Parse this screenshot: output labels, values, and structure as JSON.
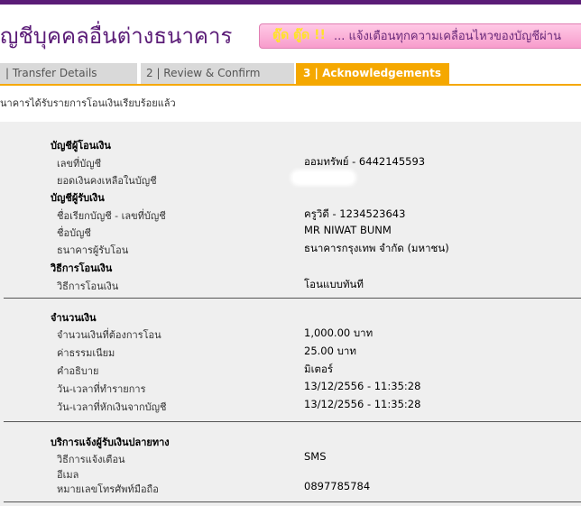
{
  "header": {
    "title": "ญชีบุคคลอื่นต่างธนาคาร",
    "banner_badge": "ตู๊ด ตู๊ด !!",
    "banner_text": "... แจ้งเตือนทุกความเคลื่อนไหวของบัญชีผ่าน"
  },
  "colors": {
    "brand": "#5b1c77",
    "active_tab": "#f5a800",
    "inactive_tab": "#d9d9d9",
    "panel": "#efefef"
  },
  "tabs": [
    {
      "label": "| Transfer Details"
    },
    {
      "label": "2 | Review & Confirm"
    },
    {
      "label": "3 | Acknowledgements"
    }
  ],
  "message": "นาคารได้รับรายการโอนเงินเรียบร้อยแล้ว",
  "sections": {
    "from_account": {
      "title": "บัญชีผู้โอนเงิน",
      "account_no_label": "เลขที่บัญชี",
      "account_no_value": "ออมทรัพย์ - 6442145593",
      "balance_label": "ยอดเงินคงเหลือในบัญชี"
    },
    "to_account": {
      "title": "บัญชีผู้รับเงิน",
      "alias_label": "ชื่อเรียกบัญชี - เลขที่บัญชี",
      "alias_value": "ครูวิดี - 1234523643",
      "name_label": "ชื่อบัญชี",
      "name_value": "MR NIWAT BUNM",
      "bank_label": "ธนาคารผู้รับโอน",
      "bank_value": "ธนาคารกรุงเทพ จำกัด (มหาชน)"
    },
    "method": {
      "title": "วิธีการโอนเงิน",
      "method_label": "วิธีการโอนเงิน",
      "method_value": "โอนแบบทันที"
    },
    "amount": {
      "title": "จำนวนเงิน",
      "amount_label": "จำนวนเงินที่ต้องการโอน",
      "amount_value": "1,000.00 บาท",
      "fee_label": "ค่าธรรมเนียม",
      "fee_value": "25.00  บาท",
      "memo_label": "คำอธิบาย",
      "memo_value": "มิเตอร์",
      "txn_time_label": "วัน-เวลาที่ทำรายการ",
      "txn_time_value": "13/12/2556 - 11:35:28",
      "debit_time_label": "วัน-เวลาที่หักเงินจากบัญชี",
      "debit_time_value": "13/12/2556 - 11:35:28"
    },
    "notify": {
      "title": "บริการแจ้งผู้รับเงินปลายทาง",
      "channel_label": "วิธีการแจ้งเตือน",
      "channel_value": "SMS",
      "email_label": "อีเมล",
      "phone_label": "หมายเลขโทรศัพท์มือถือ",
      "phone_value": "0897785784"
    }
  }
}
